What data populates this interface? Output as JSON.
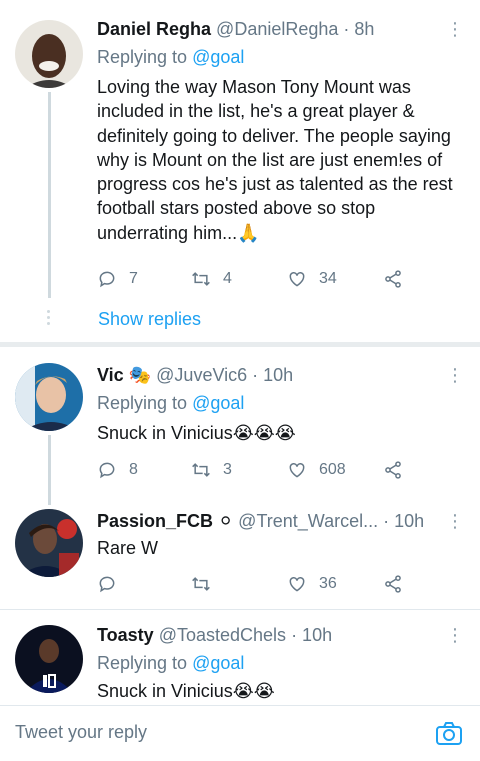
{
  "tweets": [
    {
      "name": "Daniel Regha",
      "handle": "@DanielRegha",
      "time": "· 8h",
      "replying_prefix": "Replying to",
      "replying_to": "@goal",
      "text": "Loving the way Mason Tony Mount was included in the list, he's a great player & definitely going to deliver. The people saying why is Mount on the list are just enem!es of progress cos he's just as talented as the rest football stars posted above so stop underrating him...🙏",
      "replies": "7",
      "retweets": "4",
      "likes": "34",
      "show_replies": "Show replies"
    },
    {
      "name": "Vic",
      "name_emoji": "🎭",
      "handle": "@JuveVic6",
      "time": "· 10h",
      "replying_prefix": "Replying to",
      "replying_to": "@goal",
      "text": "Snuck in Vinicius😭😭😭",
      "replies": "8",
      "retweets": "3",
      "likes": "608"
    },
    {
      "name": "Passion_FCB",
      "name_emoji": "⚪",
      "handle": "@Trent_Warcel...",
      "time": "· 10h",
      "text": "Rare W",
      "replies": "",
      "retweets": "",
      "likes": "36"
    },
    {
      "name": "Toasty",
      "handle": "@ToastedChels",
      "time": "· 10h",
      "replying_prefix": "Replying to",
      "replying_to": "@goal",
      "text": "Snuck in Vinicius😭😭"
    }
  ],
  "composer": {
    "placeholder": "Tweet your reply"
  },
  "icons": {
    "reply": "reply-icon",
    "retweet": "retweet-icon",
    "like": "heart-icon",
    "share": "share-icon",
    "more": "more-vertical-icon",
    "camera": "camera-icon"
  },
  "colors": {
    "accent": "#1da1f2",
    "secondary_text": "#657786",
    "primary_text": "#14171a",
    "divider": "#e1e8ed"
  }
}
